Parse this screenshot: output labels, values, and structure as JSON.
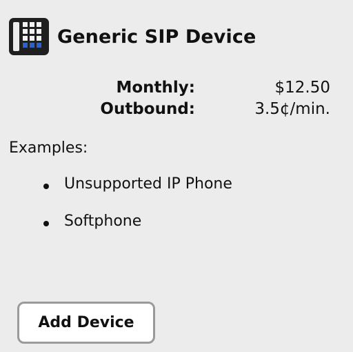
{
  "device": {
    "title": "Generic SIP Device",
    "icon": "phone-keypad-icon"
  },
  "pricing": [
    {
      "label": "Monthly:",
      "value": "$12.50"
    },
    {
      "label": "Outbound:",
      "value": "3.5¢/min."
    }
  ],
  "examples": {
    "heading": "Examples:",
    "items": [
      "Unsupported IP Phone",
      "Softphone"
    ]
  },
  "actions": {
    "add_device_label": "Add Device"
  },
  "colors": {
    "background": "#ececec",
    "icon_dark": "#1f1f1f",
    "icon_accent": "#2d63c7",
    "button_border": "#9a9a9a"
  }
}
